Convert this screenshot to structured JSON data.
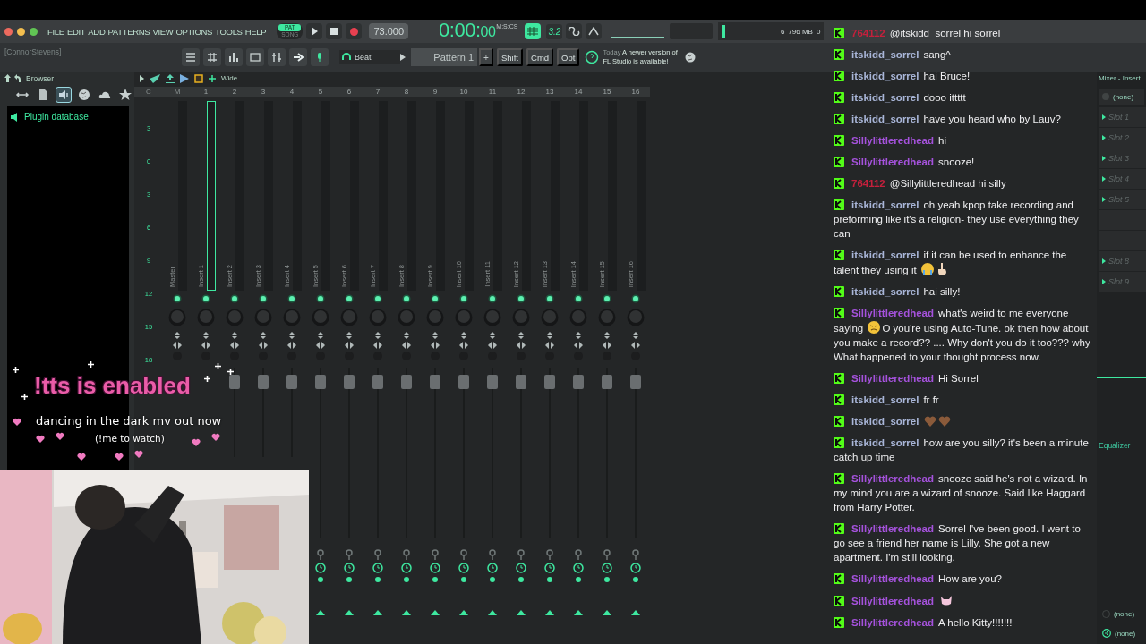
{
  "menu": [
    "FILE",
    "EDIT",
    "ADD",
    "PATTERNS",
    "VIEW",
    "OPTIONS",
    "TOOLS",
    "HELP"
  ],
  "transport": {
    "modes": [
      {
        "label": "PAT",
        "selected": true
      },
      {
        "label": "SONG",
        "selected": false
      }
    ],
    "tempo": "73.000",
    "time": "0:00:",
    "time_fraction": "00",
    "time_unit": "M:S:CS",
    "snap": "3.2"
  },
  "meters": {
    "cpu": "6",
    "memory": "796 MB",
    "voices": "0"
  },
  "toolbar": {
    "user": "[ConnorStevens]",
    "preset": "Beat",
    "pattern": "Pattern 1",
    "pattern_add": "+",
    "modifier_keys": [
      "Shift",
      "Cmd",
      "Opt"
    ],
    "news_day": "Today",
    "news": "A newer version of FL Studio is available!"
  },
  "browser": {
    "title": "Browser",
    "tabs": [
      {
        "kind": "move",
        "selected": false
      },
      {
        "kind": "file",
        "selected": false
      },
      {
        "kind": "plugin",
        "selected": true
      },
      {
        "kind": "globe",
        "selected": false
      },
      {
        "kind": "cloud",
        "selected": false
      },
      {
        "kind": "star",
        "selected": false
      }
    ],
    "items": [
      {
        "label": "Plugin database"
      }
    ]
  },
  "mixer": {
    "view": "Wide",
    "header": [
      "C",
      "M",
      "1",
      "2",
      "3",
      "4",
      "5",
      "6",
      "7",
      "8",
      "9",
      "10",
      "11",
      "12",
      "13",
      "14",
      "15",
      "16"
    ],
    "scale": [
      "3",
      "0",
      "3",
      "6",
      "9",
      "12",
      "15",
      "18"
    ],
    "tracks": [
      {
        "name": "Master",
        "selected": false
      },
      {
        "name": "Insert 1",
        "selected": true
      },
      {
        "name": "Insert 2",
        "selected": false
      },
      {
        "name": "Insert 3",
        "selected": false
      },
      {
        "name": "Insert 4",
        "selected": false
      },
      {
        "name": "Insert 5",
        "selected": false
      },
      {
        "name": "Insert 6",
        "selected": false
      },
      {
        "name": "Insert 7",
        "selected": false
      },
      {
        "name": "Insert 8",
        "selected": false
      },
      {
        "name": "Insert 9",
        "selected": false
      },
      {
        "name": "Insert 10",
        "selected": false
      },
      {
        "name": "Insert 11",
        "selected": false
      },
      {
        "name": "Insert 12",
        "selected": false
      },
      {
        "name": "Insert 13",
        "selected": false
      },
      {
        "name": "Insert 14",
        "selected": false
      },
      {
        "name": "Insert 15",
        "selected": false
      },
      {
        "name": "Insert 16",
        "selected": false
      }
    ]
  },
  "insert_panel": {
    "title": "Mixer - Insert",
    "input": "(none)",
    "slots": [
      {
        "kind": "slot",
        "label": "Slot 1"
      },
      {
        "kind": "slot",
        "label": "Slot 2"
      },
      {
        "kind": "slot",
        "label": "Slot 3"
      },
      {
        "kind": "slot",
        "label": "Slot 4"
      },
      {
        "kind": "slot",
        "label": "Slot 5"
      },
      {
        "kind": "covered"
      },
      {
        "kind": "covered"
      },
      {
        "kind": "slot",
        "label": "Slot 8"
      },
      {
        "kind": "slot",
        "label": "Slot 9"
      }
    ],
    "effect": "Equalizer",
    "outputs": [
      "(none)",
      "(none)"
    ]
  },
  "overlay": {
    "command": "!tts is enabled",
    "announcement": "dancing in the dark mv out now",
    "hint": "(!me to watch)"
  },
  "chat": {
    "messages": [
      {
        "user": "764112",
        "color": "#c4203c",
        "parts": [
          {
            "kind": "text",
            "text": "@itskidd_sorrel hi sorrel"
          }
        ]
      },
      {
        "user": "itskidd_sorrel",
        "color": "#a9b6d8",
        "parts": [
          {
            "kind": "text",
            "text": "sang^"
          }
        ]
      },
      {
        "user": "itskidd_sorrel",
        "color": "#a9b6d8",
        "parts": [
          {
            "kind": "text",
            "text": "hai Bruce!"
          }
        ]
      },
      {
        "user": "itskidd_sorrel",
        "color": "#a9b6d8",
        "parts": [
          {
            "kind": "text",
            "text": "dooo ittttt"
          }
        ]
      },
      {
        "user": "itskidd_sorrel",
        "color": "#a9b6d8",
        "parts": [
          {
            "kind": "text",
            "text": "have you heard who by Lauv?"
          }
        ]
      },
      {
        "user": "Sillylittleredhead",
        "color": "#a552dc",
        "parts": [
          {
            "kind": "text",
            "text": "hi"
          }
        ]
      },
      {
        "user": "Sillylittleredhead",
        "color": "#a552dc",
        "parts": [
          {
            "kind": "text",
            "text": "snooze!"
          }
        ]
      },
      {
        "user": "764112",
        "color": "#c4203c",
        "parts": [
          {
            "kind": "text",
            "text": "@Sillylittleredhead hi silly"
          }
        ]
      },
      {
        "user": "itskidd_sorrel",
        "color": "#a9b6d8",
        "parts": [
          {
            "kind": "text",
            "text": "oh yeah kpop take recording and preforming like it's a religion- they use everything they can"
          }
        ]
      },
      {
        "user": "itskidd_sorrel",
        "color": "#a9b6d8",
        "parts": [
          {
            "kind": "text",
            "text": "if it can be used to enhance the talent they using it"
          },
          {
            "kind": "crying"
          },
          {
            "kind": "hand"
          }
        ]
      },
      {
        "user": "itskidd_sorrel",
        "color": "#a9b6d8",
        "parts": [
          {
            "kind": "text",
            "text": "hai silly!"
          }
        ]
      },
      {
        "user": "Sillylittleredhead",
        "color": "#a552dc",
        "parts": [
          {
            "kind": "text",
            "text": "what's weird to me everyone saying"
          },
          {
            "kind": "weary"
          },
          {
            "kind": "text",
            "text": "O you're using Auto-Tune. ok then how about you make a record?? .... Why don't you do it too??? why What happened to your thought process now."
          }
        ]
      },
      {
        "user": "Sillylittleredhead",
        "color": "#a552dc",
        "parts": [
          {
            "kind": "text",
            "text": "Hi Sorrel"
          }
        ]
      },
      {
        "user": "itskidd_sorrel",
        "color": "#a9b6d8",
        "parts": [
          {
            "kind": "text",
            "text": "fr fr"
          }
        ]
      },
      {
        "user": "itskidd_sorrel",
        "color": "#a9b6d8",
        "parts": [
          {
            "kind": "heart"
          },
          {
            "kind": "heart"
          }
        ]
      },
      {
        "user": "itskidd_sorrel",
        "color": "#a9b6d8",
        "parts": [
          {
            "kind": "text",
            "text": "how are you silly? it's been a minute catch up time"
          }
        ]
      },
      {
        "user": "Sillylittleredhead",
        "color": "#a552dc",
        "parts": [
          {
            "kind": "text",
            "text": "snooze said he's not a wizard. In my mind you are a wizard of snooze. Said like Haggard from Harry Potter."
          }
        ]
      },
      {
        "user": "Sillylittleredhead",
        "color": "#a552dc",
        "parts": [
          {
            "kind": "text",
            "text": "Sorrel I've been good. I went to go see a friend her name is Lilly. She got a new apartment. I'm still looking."
          }
        ]
      },
      {
        "user": "Sillylittleredhead",
        "color": "#a552dc",
        "parts": [
          {
            "kind": "text",
            "text": "How are you?"
          }
        ]
      },
      {
        "user": "Sillylittleredhead",
        "color": "#a552dc",
        "parts": [
          {
            "kind": "cat"
          }
        ]
      },
      {
        "user": "Sillylittleredhead",
        "color": "#a552dc",
        "parts": [
          {
            "kind": "text",
            "text": "A hello Kitty!!!!!!!"
          }
        ]
      }
    ]
  }
}
